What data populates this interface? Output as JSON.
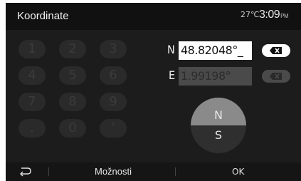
{
  "header": {
    "title": "Koordinate",
    "temperature": "27℃",
    "time": "3:09",
    "ampm": "PM"
  },
  "keypad": {
    "keys": [
      "1",
      "2",
      "3",
      "4",
      "5",
      "6",
      "7",
      "8",
      "9",
      ".",
      "0",
      "'"
    ]
  },
  "coordinates": {
    "north": {
      "label": "N",
      "value": "48.82048°_"
    },
    "east": {
      "label": "E",
      "value": "1.99198°"
    }
  },
  "compass": {
    "top": "N",
    "bottom": "S"
  },
  "footer": {
    "options": "Možnosti",
    "ok": "OK"
  },
  "colors": {
    "background": "#1c1c1c",
    "active_field": "#ffffff",
    "inactive_field": "#4a4a4a",
    "compass_top": "#8a8a8a",
    "compass_bottom": "#2f2f2f"
  },
  "icons": {
    "back": "back-arrow-icon",
    "clear": "backspace-x-icon"
  }
}
